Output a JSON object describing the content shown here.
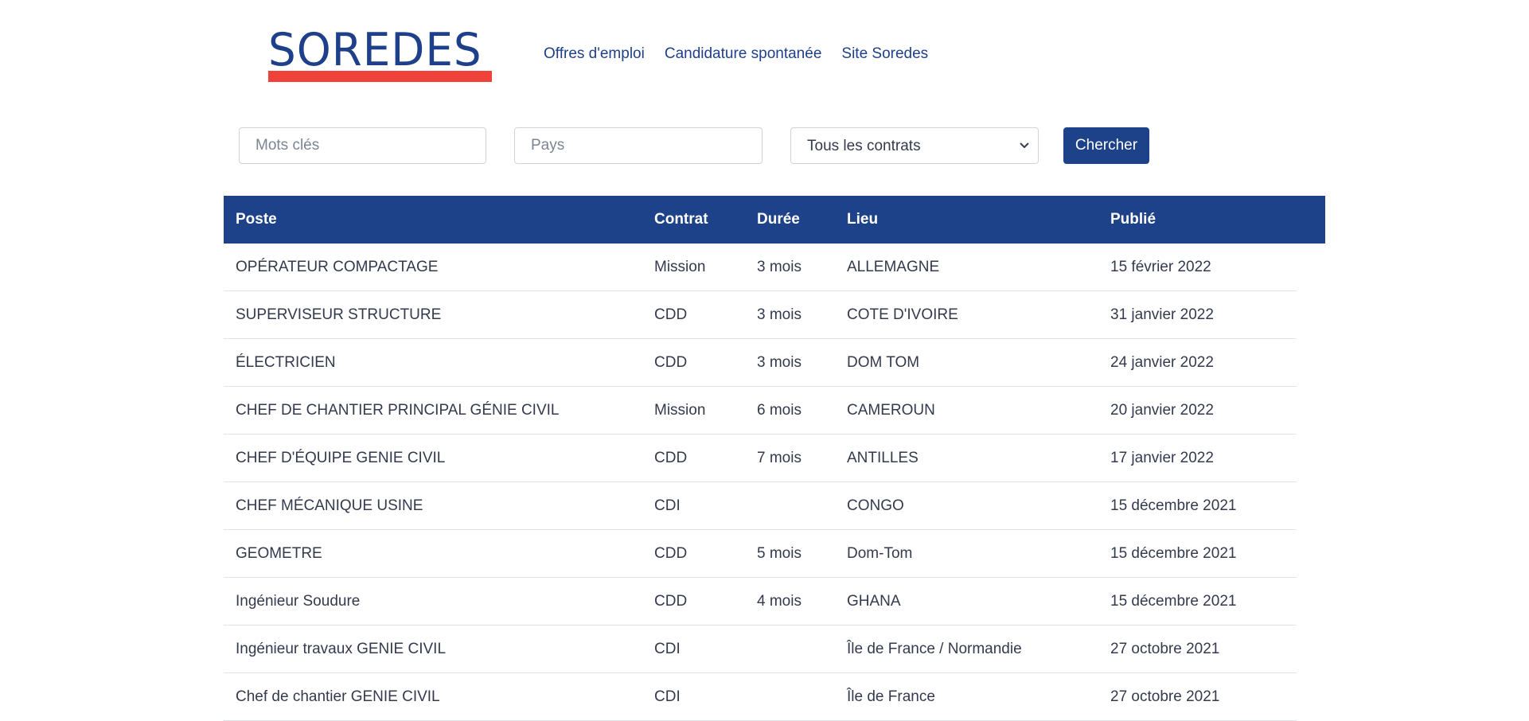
{
  "brand": {
    "logo_text": "SOREDES",
    "colors": {
      "primary": "#1e428a",
      "accent": "#f0423a"
    }
  },
  "nav": {
    "items": [
      {
        "label": "Offres d'emploi"
      },
      {
        "label": "Candidature spontanée"
      },
      {
        "label": "Site Soredes"
      }
    ]
  },
  "search": {
    "keywords_placeholder": "Mots clés",
    "keywords_value": "",
    "country_placeholder": "Pays",
    "country_value": "",
    "contract_selected": "Tous les contrats",
    "contract_icon": "chevron-down-icon",
    "button_label": "Chercher"
  },
  "table": {
    "headers": {
      "poste": "Poste",
      "contrat": "Contrat",
      "duree": "Durée",
      "lieu": "Lieu",
      "publie": "Publié"
    },
    "rows": [
      {
        "poste": "OPÉRATEUR COMPACTAGE",
        "contrat": "Mission",
        "duree": "3 mois",
        "lieu": "ALLEMAGNE",
        "publie": "15 février 2022"
      },
      {
        "poste": "SUPERVISEUR STRUCTURE",
        "contrat": "CDD",
        "duree": "3 mois",
        "lieu": "COTE D'IVOIRE",
        "publie": "31 janvier 2022"
      },
      {
        "poste": "ÉLECTRICIEN",
        "contrat": "CDD",
        "duree": "3 mois",
        "lieu": "DOM TOM",
        "publie": "24 janvier 2022"
      },
      {
        "poste": "CHEF DE CHANTIER PRINCIPAL GÉNIE CIVIL",
        "contrat": "Mission",
        "duree": "6 mois",
        "lieu": "CAMEROUN",
        "publie": "20 janvier 2022"
      },
      {
        "poste": "CHEF D'ÉQUIPE GENIE CIVIL",
        "contrat": "CDD",
        "duree": "7 mois",
        "lieu": "ANTILLES",
        "publie": "17 janvier 2022"
      },
      {
        "poste": "CHEF MÉCANIQUE USINE",
        "contrat": "CDI",
        "duree": "",
        "lieu": "CONGO",
        "publie": "15 décembre 2021"
      },
      {
        "poste": "GEOMETRE",
        "contrat": "CDD",
        "duree": "5 mois",
        "lieu": "Dom-Tom",
        "publie": "15 décembre 2021"
      },
      {
        "poste": "Ingénieur Soudure",
        "contrat": "CDD",
        "duree": "4 mois",
        "lieu": "GHANA",
        "publie": "15 décembre 2021"
      },
      {
        "poste": "Ingénieur travaux GENIE CIVIL",
        "contrat": "CDI",
        "duree": "",
        "lieu": "Île de France / Normandie",
        "publie": "27 octobre 2021"
      },
      {
        "poste": "Chef de chantier GENIE CIVIL",
        "contrat": "CDI",
        "duree": "",
        "lieu": "Île de France",
        "publie": "27 octobre 2021"
      }
    ]
  }
}
